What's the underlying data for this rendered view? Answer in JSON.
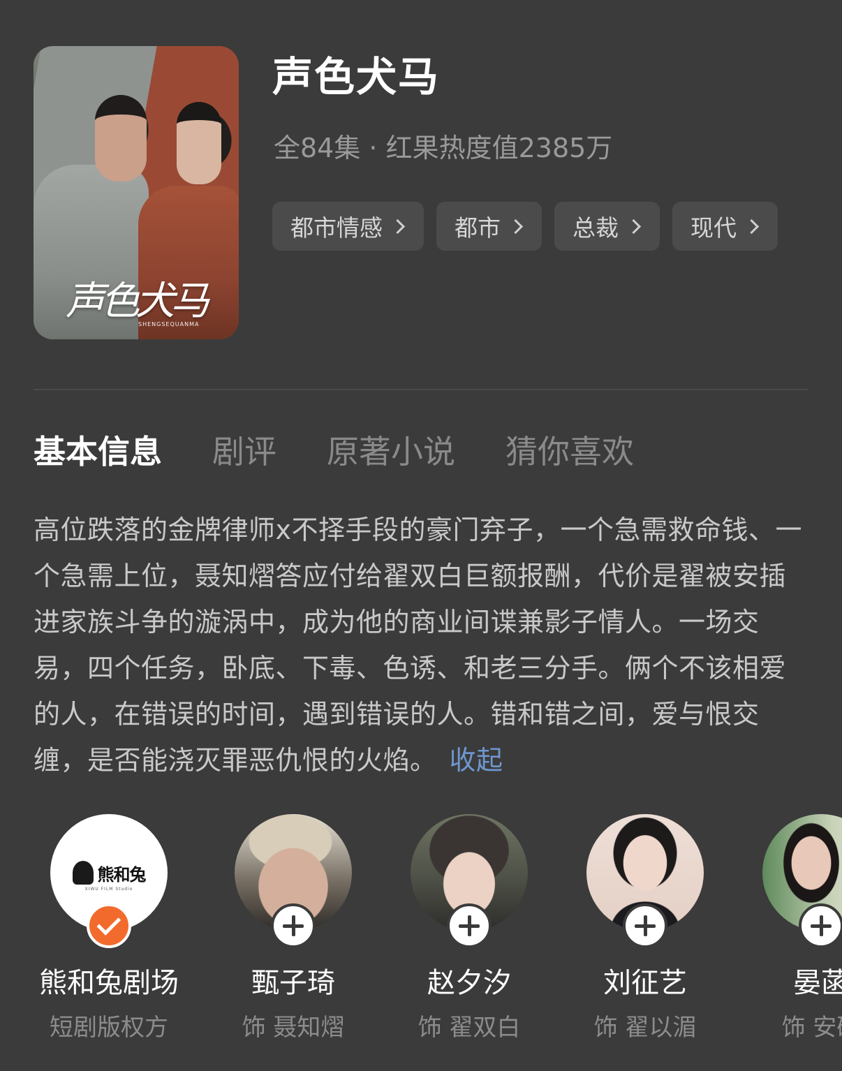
{
  "header": {
    "poster_title": "声色犬马",
    "poster_subtitle": "SHENGSEQUANMA",
    "title": "声色犬马",
    "meta": "全84集 · 红果热度值2385万",
    "tags": [
      "都市情感",
      "都市",
      "总裁",
      "现代"
    ]
  },
  "tabs": [
    "基本信息",
    "剧评",
    "原著小说",
    "猜你喜欢"
  ],
  "active_tab": "基本信息",
  "synopsis": {
    "text": "高位跌落的金牌律师x不择手段的豪门弃子，一个急需救命钱、一个急需上位，聂知熠答应付给翟双白巨额报酬，代价是翟被安插进家族斗争的漩涡中，成为他的商业间谍兼影子情人。一场交易，四个任务，卧底、下毒、色诱、和老三分手。俩个不该相爱的人，在错误的时间，遇到错误的人。错和错之间，爱与恨交缠，是否能浇灭罪恶仇恨的火焰。",
    "collapse_label": "收起"
  },
  "cast": [
    {
      "name": "熊和兔剧场",
      "role": "短剧版权方",
      "followed": true,
      "logo_text": "熊和兔",
      "logo_small": "XIWU FILM Studio"
    },
    {
      "name": "甄子琦",
      "role": "饰 聂知熠",
      "followed": false
    },
    {
      "name": "赵夕汐",
      "role": "饰 翟双白",
      "followed": false
    },
    {
      "name": "刘征艺",
      "role": "饰 翟以湄",
      "followed": false
    },
    {
      "name": "晏菡",
      "role": "饰 安硕",
      "followed": false
    }
  ],
  "colors": {
    "background": "#3b3b3b",
    "link": "#6f97cf",
    "followed_badge": "#f26b2c"
  }
}
